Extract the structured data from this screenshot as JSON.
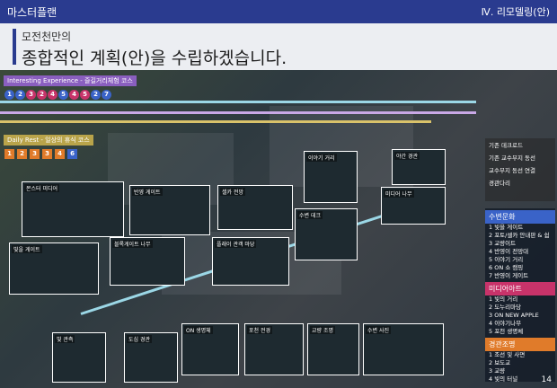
{
  "header": {
    "section": "마스터플랜",
    "chapter": "Ⅳ. 리모델링(안)",
    "subtitle": "모전천만의",
    "title": "종합적인 계획(안)을 수립하겠습니다."
  },
  "courses": {
    "a": "Interesting Experience - 즐길거리체험 코스",
    "b": "Daily Rest - 일상의 휴식 코스"
  },
  "key": [
    "기존 데크로드",
    "기존 교수부지 동선",
    "교수부지 동선 연결",
    "경관다리"
  ],
  "legend": {
    "h1": "수변문화",
    "l1": [
      "1 빛을 게이트",
      "2 포토/셀카 안내판 & 쉼",
      "3 교량이트",
      "4 반영이 전망대",
      "5 이야기 거리",
      "6 ON 쇼 캠핑",
      "7 반영이 게이트"
    ],
    "h2": "미디어아트",
    "l2": [
      "1 빛의 거리",
      "2 도누리마당",
      "3 ON NEW APPLE",
      "4 이야기나무",
      "5 포천 생명체"
    ],
    "h3": "경관조명",
    "l3": [
      "1 조선 및 사면",
      "2 보도교",
      "3 교량",
      "4 빛의 터널"
    ]
  },
  "photos": [
    "빛을 게이트",
    "블록게이트 나무",
    "몬스터 미디어",
    "반영 게이트",
    "플래이 관객 마당",
    "셀카 전망",
    "수변 데크",
    "이야기 거리",
    "미디어 나무",
    "야간 경관",
    "빛 관측",
    "도심 경관",
    "ON 생명체",
    "포천 전경",
    "교량 조명",
    "수변 사진"
  ],
  "page": "14"
}
